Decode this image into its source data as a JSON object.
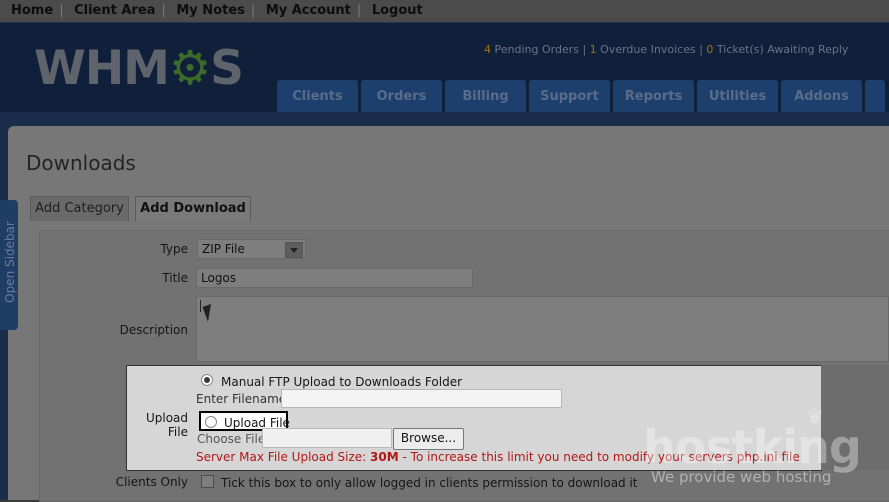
{
  "topnav": {
    "items": [
      "Home",
      "Client Area",
      "My Notes",
      "My Account",
      "Logout"
    ]
  },
  "header": {
    "logo_text": "WHMCS",
    "notices": {
      "pending_orders_count": "4",
      "pending_orders_label": "Pending Orders",
      "overdue_invoices_count": "1",
      "overdue_invoices_label": "Overdue Invoices",
      "tickets_count": "0",
      "tickets_label": "Ticket(s) Awaiting Reply"
    },
    "tabs": [
      "Clients",
      "Orders",
      "Billing",
      "Support",
      "Reports",
      "Utilities",
      "Addons"
    ]
  },
  "sidebar": {
    "toggle_label": "Open Sidebar"
  },
  "page": {
    "title": "Downloads",
    "subtabs": [
      "Add Category",
      "Add Download"
    ],
    "active_subtab": "Add Download"
  },
  "form": {
    "type_label": "Type",
    "type_value": "ZIP File",
    "title_label": "Title",
    "title_value": "Logos",
    "description_label": "Description",
    "upload_file_label": "Upload File",
    "manual_ftp_label": "Manual FTP Upload to Downloads Folder",
    "enter_filename_label": "Enter Filename:",
    "upload_file_option_label": "Upload File",
    "choose_file_label": "Choose File:",
    "browse_label": "Browse...",
    "warning_prefix": "Server Max File Upload Size: ",
    "warning_size": "30M",
    "warning_suffix": " - To increase this limit you need to modify your servers php.ini file",
    "clients_only_label": "Clients Only",
    "clients_only_text": "Tick this box to only allow logged in clients permission to download it"
  },
  "watermark": {
    "brand": "hostking",
    "tagline": "We provide web hosting"
  },
  "colors": {
    "header_bg": "#10203a",
    "tab_bg": "#1c3f6e",
    "warning": "#b11818",
    "notice_count": "#a07410"
  }
}
